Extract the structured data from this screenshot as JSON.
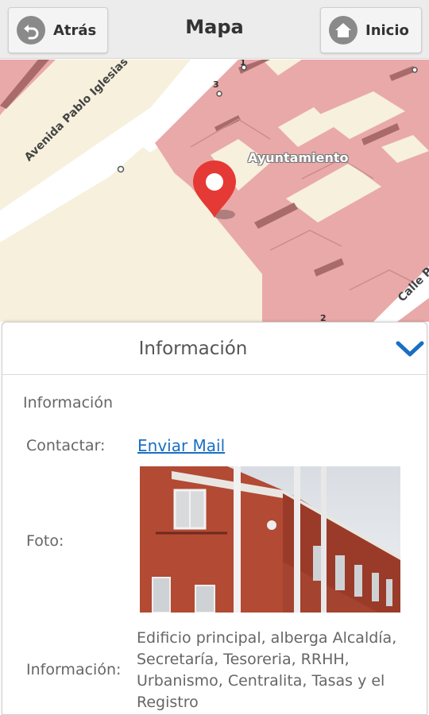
{
  "header": {
    "back_label": "Atrás",
    "title": "Mapa",
    "home_label": "Inicio"
  },
  "map": {
    "labels": {
      "avenue": "Avenida Pablo Iglesias",
      "townhall": "Ayuntamiento",
      "street": "Calle Pra"
    },
    "house_numbers": [
      "1",
      "3",
      "2"
    ],
    "colors": {
      "buildings": "#e9a9a9",
      "ground": "#f7f0dd",
      "marker": "#e53935"
    }
  },
  "panel": {
    "title": "Información",
    "section_title": "Información",
    "contact_label": "Contactar:",
    "contact_link": "Enviar Mail",
    "photo_label": "Foto:",
    "info_label": "Información:",
    "info_text": "Edificio principal, alberga Alcaldía, Secretaría, Tesoreria, RRHH, Urbanismo, Centralita, Tasas y el Registro"
  },
  "icons": {
    "back": "back-arrow-icon",
    "home": "home-icon",
    "collapse": "chevron-down-icon",
    "marker": "map-marker-icon"
  }
}
